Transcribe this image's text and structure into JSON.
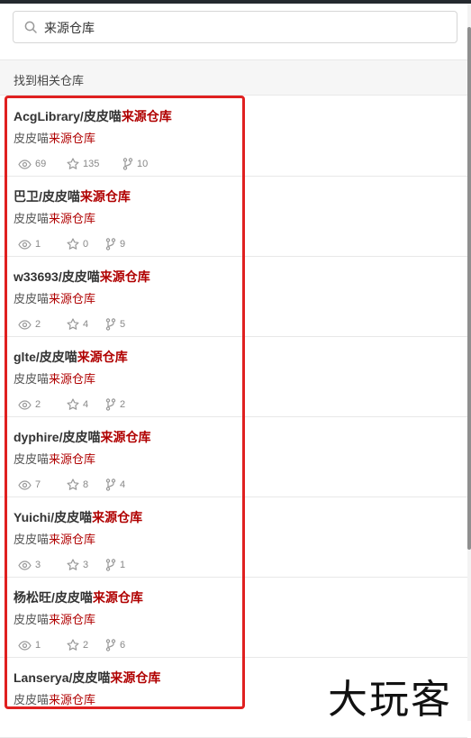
{
  "search": {
    "value": "来源仓库"
  },
  "results_heading": "找到相关仓库",
  "highlight_term": "来源仓库",
  "items": [
    {
      "owner": "AcgLibrary",
      "repo_prefix": "皮皮喵",
      "desc_prefix": "皮皮喵",
      "watch": "69",
      "star": "135",
      "fork": "10"
    },
    {
      "owner": "巴卫",
      "repo_prefix": "皮皮喵",
      "desc_prefix": "皮皮喵",
      "watch": "1",
      "star": "0",
      "fork": "9"
    },
    {
      "owner": "w33693",
      "repo_prefix": "皮皮喵",
      "desc_prefix": "皮皮喵",
      "watch": "2",
      "star": "4",
      "fork": "5"
    },
    {
      "owner": "glte",
      "repo_prefix": "皮皮喵",
      "desc_prefix": "皮皮喵",
      "watch": "2",
      "star": "4",
      "fork": "2"
    },
    {
      "owner": "dyphire",
      "repo_prefix": "皮皮喵",
      "desc_prefix": "皮皮喵",
      "watch": "7",
      "star": "8",
      "fork": "4"
    },
    {
      "owner": "Yuichi",
      "repo_prefix": "皮皮喵",
      "desc_prefix": "皮皮喵",
      "watch": "3",
      "star": "3",
      "fork": "1"
    },
    {
      "owner": "杨松旺",
      "repo_prefix": "皮皮喵",
      "desc_prefix": "皮皮喵",
      "watch": "1",
      "star": "2",
      "fork": "6"
    },
    {
      "owner": "Lanserya",
      "repo_prefix": "皮皮喵",
      "desc_prefix": "皮皮喵",
      "watch": "",
      "star": "",
      "fork": ""
    }
  ],
  "icons": {
    "search": "search-icon",
    "watch": "eye-icon",
    "star": "star-icon",
    "fork": "fork-icon"
  },
  "colors": {
    "highlight": "#b00000",
    "annotation_box": "#e02020"
  },
  "watermark": "大玩客"
}
